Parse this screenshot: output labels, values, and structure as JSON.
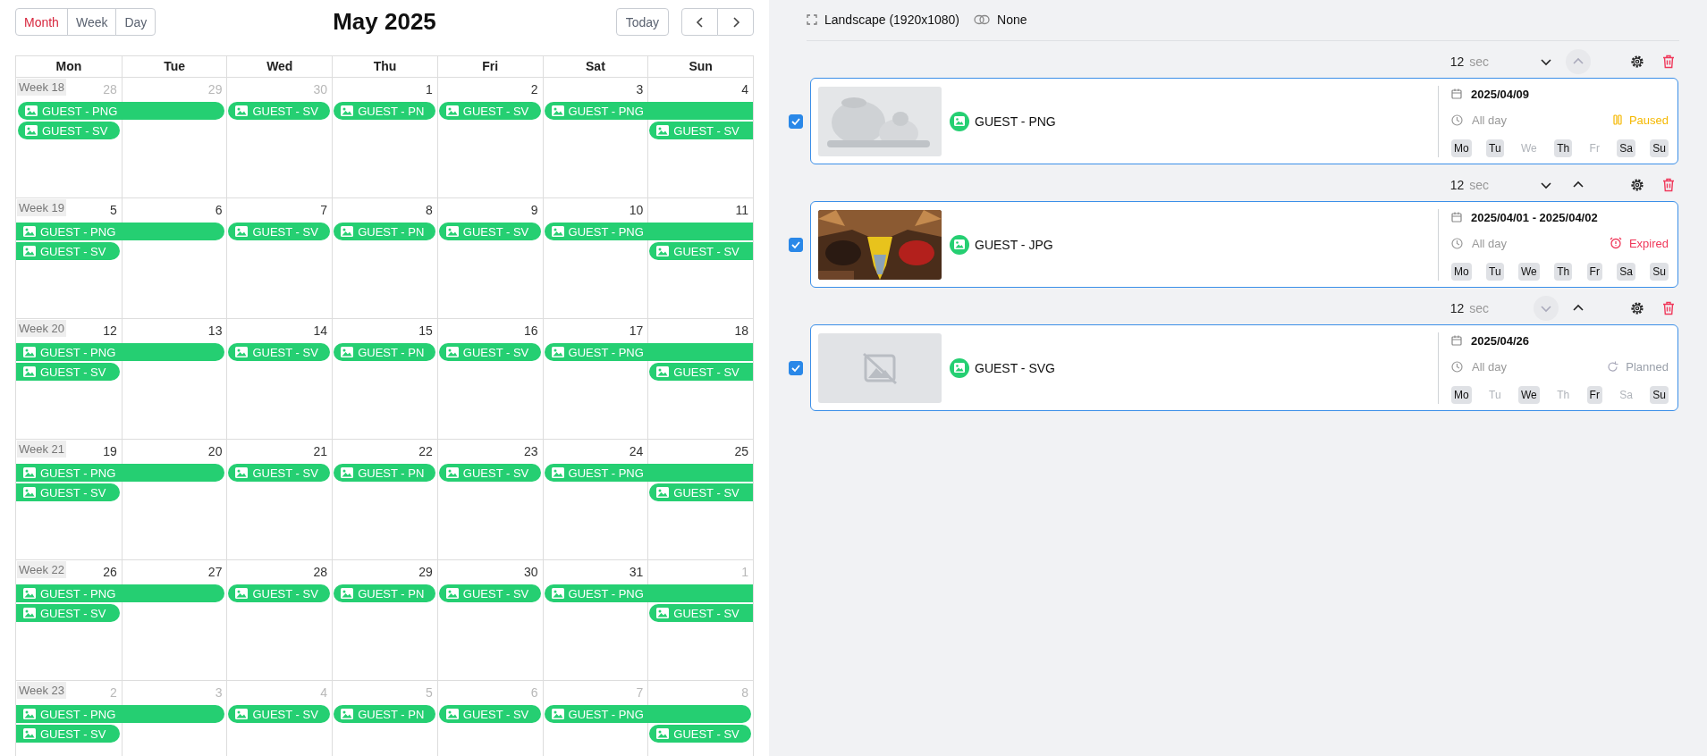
{
  "calendar": {
    "views": [
      {
        "label": "Month",
        "selected": true
      },
      {
        "label": "Week",
        "selected": false
      },
      {
        "label": "Day",
        "selected": false
      }
    ],
    "title": "May 2025",
    "today_button": "Today",
    "weekdays": [
      "Mon",
      "Tue",
      "Wed",
      "Thu",
      "Fri",
      "Sat",
      "Sun"
    ],
    "weeks": [
      {
        "label": "Week 18",
        "days": [
          {
            "date": "28",
            "muted": true,
            "events": [
              {
                "label": "GUEST - PNG",
                "spans_next_day": true,
                "continues_before": false,
                "continues_after": false
              },
              {
                "label": "GUEST - SV",
                "spans_next_day": false,
                "continues_before": false,
                "continues_after": false
              }
            ]
          },
          {
            "date": "29",
            "muted": true
          },
          {
            "date": "30",
            "muted": true,
            "events": [
              {
                "label": "GUEST - SV",
                "spans_next_day": false,
                "continues_before": false,
                "continues_after": false
              }
            ]
          },
          {
            "date": "1",
            "muted": false,
            "events": [
              {
                "label": "GUEST - PN",
                "spans_next_day": false,
                "continues_before": false,
                "continues_after": false
              }
            ]
          },
          {
            "date": "2",
            "muted": false,
            "events": [
              {
                "label": "GUEST - SV",
                "spans_next_day": false,
                "continues_before": false,
                "continues_after": false
              }
            ]
          },
          {
            "date": "3",
            "muted": false,
            "events": [
              {
                "label": "GUEST - PNG",
                "spans_next_day": true,
                "continues_before": false,
                "continues_after": true
              }
            ]
          },
          {
            "date": "4",
            "muted": false,
            "events": [
              {
                "label": "GUEST - SV",
                "continues_before": false,
                "continues_after": true
              }
            ]
          }
        ]
      },
      {
        "label": "Week 19",
        "days": [
          {
            "date": "5",
            "muted": false,
            "events": [
              {
                "label": "GUEST - PNG",
                "spans_next_day": true,
                "continues_before": true,
                "continues_after": false
              },
              {
                "label": "GUEST - SV",
                "spans_next_day": false,
                "continues_before": true,
                "continues_after": false
              }
            ]
          },
          {
            "date": "6",
            "muted": false
          },
          {
            "date": "7",
            "muted": false,
            "events": [
              {
                "label": "GUEST - SV",
                "spans_next_day": false,
                "continues_before": false,
                "continues_after": false
              }
            ]
          },
          {
            "date": "8",
            "muted": false,
            "events": [
              {
                "label": "GUEST - PN",
                "spans_next_day": false,
                "continues_before": false,
                "continues_after": false
              }
            ]
          },
          {
            "date": "9",
            "muted": false,
            "events": [
              {
                "label": "GUEST - SV",
                "spans_next_day": false,
                "continues_before": false,
                "continues_after": false
              }
            ]
          },
          {
            "date": "10",
            "muted": false,
            "events": [
              {
                "label": "GUEST - PNG",
                "spans_next_day": true,
                "continues_before": false,
                "continues_after": true
              }
            ]
          },
          {
            "date": "11",
            "muted": false,
            "events": [
              {
                "label": "GUEST - SV",
                "continues_before": false,
                "continues_after": true
              }
            ]
          }
        ]
      },
      {
        "label": "Week 20",
        "days": [
          {
            "date": "12",
            "muted": false,
            "events": [
              {
                "label": "GUEST - PNG",
                "spans_next_day": true,
                "continues_before": true,
                "continues_after": false
              },
              {
                "label": "GUEST - SV",
                "spans_next_day": false,
                "continues_before": true,
                "continues_after": false
              }
            ]
          },
          {
            "date": "13",
            "muted": false
          },
          {
            "date": "14",
            "muted": false,
            "events": [
              {
                "label": "GUEST - SV",
                "spans_next_day": false,
                "continues_before": false,
                "continues_after": false
              }
            ]
          },
          {
            "date": "15",
            "muted": false,
            "events": [
              {
                "label": "GUEST - PN",
                "spans_next_day": false,
                "continues_before": false,
                "continues_after": false
              }
            ]
          },
          {
            "date": "16",
            "muted": false,
            "events": [
              {
                "label": "GUEST - SV",
                "spans_next_day": false,
                "continues_before": false,
                "continues_after": false
              }
            ]
          },
          {
            "date": "17",
            "muted": false,
            "events": [
              {
                "label": "GUEST - PNG",
                "spans_next_day": true,
                "continues_before": false,
                "continues_after": true
              }
            ]
          },
          {
            "date": "18",
            "muted": false,
            "events": [
              {
                "label": "GUEST - SV",
                "continues_before": false,
                "continues_after": true
              }
            ]
          }
        ]
      },
      {
        "label": "Week 21",
        "days": [
          {
            "date": "19",
            "muted": false,
            "events": [
              {
                "label": "GUEST - PNG",
                "spans_next_day": true,
                "continues_before": true,
                "continues_after": false
              },
              {
                "label": "GUEST - SV",
                "spans_next_day": false,
                "continues_before": true,
                "continues_after": false
              }
            ]
          },
          {
            "date": "20",
            "muted": false
          },
          {
            "date": "21",
            "muted": false,
            "events": [
              {
                "label": "GUEST - SV",
                "spans_next_day": false,
                "continues_before": false,
                "continues_after": false
              }
            ]
          },
          {
            "date": "22",
            "muted": false,
            "events": [
              {
                "label": "GUEST - PN",
                "spans_next_day": false,
                "continues_before": false,
                "continues_after": false
              }
            ]
          },
          {
            "date": "23",
            "muted": false,
            "events": [
              {
                "label": "GUEST - SV",
                "spans_next_day": false,
                "continues_before": false,
                "continues_after": false
              }
            ]
          },
          {
            "date": "24",
            "muted": false,
            "events": [
              {
                "label": "GUEST - PNG",
                "spans_next_day": true,
                "continues_before": false,
                "continues_after": true
              }
            ]
          },
          {
            "date": "25",
            "muted": false,
            "events": [
              {
                "label": "GUEST - SV",
                "continues_before": false,
                "continues_after": true
              }
            ]
          }
        ]
      },
      {
        "label": "Week 22",
        "days": [
          {
            "date": "26",
            "muted": false,
            "events": [
              {
                "label": "GUEST - PNG",
                "spans_next_day": true,
                "continues_before": true,
                "continues_after": false
              },
              {
                "label": "GUEST - SV",
                "spans_next_day": false,
                "continues_before": true,
                "continues_after": false
              }
            ]
          },
          {
            "date": "27",
            "muted": false
          },
          {
            "date": "28",
            "muted": false,
            "events": [
              {
                "label": "GUEST - SV",
                "spans_next_day": false,
                "continues_before": false,
                "continues_after": false
              }
            ]
          },
          {
            "date": "29",
            "muted": false,
            "events": [
              {
                "label": "GUEST - PN",
                "spans_next_day": false,
                "continues_before": false,
                "continues_after": false
              }
            ]
          },
          {
            "date": "30",
            "muted": false,
            "events": [
              {
                "label": "GUEST - SV",
                "spans_next_day": false,
                "continues_before": false,
                "continues_after": false
              }
            ]
          },
          {
            "date": "31",
            "muted": false,
            "events": [
              {
                "label": "GUEST - PNG",
                "spans_next_day": true,
                "continues_before": false,
                "continues_after": true
              }
            ]
          },
          {
            "date": "1",
            "muted": true,
            "events": [
              {
                "label": "GUEST - SV",
                "continues_before": false,
                "continues_after": true
              }
            ]
          }
        ]
      },
      {
        "label": "Week 23",
        "days": [
          {
            "date": "2",
            "muted": true,
            "events": [
              {
                "label": "GUEST - PNG",
                "spans_next_day": true,
                "continues_before": true,
                "continues_after": false
              },
              {
                "label": "GUEST - SV",
                "spans_next_day": false,
                "continues_before": true,
                "continues_after": false
              }
            ]
          },
          {
            "date": "3",
            "muted": true
          },
          {
            "date": "4",
            "muted": true,
            "events": [
              {
                "label": "GUEST - SV",
                "spans_next_day": false,
                "continues_before": false,
                "continues_after": false
              }
            ]
          },
          {
            "date": "5",
            "muted": true,
            "events": [
              {
                "label": "GUEST - PN",
                "spans_next_day": false,
                "continues_before": false,
                "continues_after": false
              }
            ]
          },
          {
            "date": "6",
            "muted": true,
            "events": [
              {
                "label": "GUEST - SV",
                "spans_next_day": false,
                "continues_before": false,
                "continues_after": false
              }
            ]
          },
          {
            "date": "7",
            "muted": true,
            "events": [
              {
                "label": "GUEST - PNG",
                "spans_next_day": true,
                "continues_before": false,
                "continues_after": false
              }
            ]
          },
          {
            "date": "8",
            "muted": true,
            "events": [
              {
                "label": "GUEST - SV",
                "continues_before": false,
                "continues_after": false
              }
            ]
          }
        ]
      }
    ]
  },
  "playlist": {
    "format": "Landscape (1920x1080)",
    "transition": "None",
    "items": [
      {
        "duration": "12",
        "unit": "sec",
        "move_down": {
          "disabled": false
        },
        "move_up": {
          "disabled": true
        },
        "checked": true,
        "name": "GUEST - PNG",
        "date": "2025/04/09",
        "time": "All day",
        "status": {
          "kind": "paused",
          "label": "Paused"
        },
        "days": [
          {
            "label": "Mo",
            "active": true
          },
          {
            "label": "Tu",
            "active": true
          },
          {
            "label": "We",
            "active": false
          },
          {
            "label": "Th",
            "active": true
          },
          {
            "label": "Fr",
            "active": false
          },
          {
            "label": "Sa",
            "active": true
          },
          {
            "label": "Su",
            "active": true
          }
        ]
      },
      {
        "duration": "12",
        "unit": "sec",
        "move_down": {
          "disabled": false
        },
        "move_up": {
          "disabled": false
        },
        "checked": true,
        "name": "GUEST - JPG",
        "date": "2025/04/01 - 2025/04/02",
        "time": "All day",
        "status": {
          "kind": "expired",
          "label": "Expired"
        },
        "days": [
          {
            "label": "Mo",
            "active": true
          },
          {
            "label": "Tu",
            "active": true
          },
          {
            "label": "We",
            "active": true
          },
          {
            "label": "Th",
            "active": true
          },
          {
            "label": "Fr",
            "active": true
          },
          {
            "label": "Sa",
            "active": true
          },
          {
            "label": "Su",
            "active": true
          }
        ]
      },
      {
        "duration": "12",
        "unit": "sec",
        "move_down": {
          "disabled": true
        },
        "move_up": {
          "disabled": false
        },
        "checked": true,
        "thumbnail": {
          "kind": "placeholder"
        },
        "name": "GUEST - SVG",
        "date": "2025/04/26",
        "time": "All day",
        "status": {
          "kind": "planned",
          "label": "Planned"
        },
        "days": [
          {
            "label": "Mo",
            "active": true
          },
          {
            "label": "Tu",
            "active": false
          },
          {
            "label": "We",
            "active": true
          },
          {
            "label": "Th",
            "active": false
          },
          {
            "label": "Fr",
            "active": true
          },
          {
            "label": "Sa",
            "active": false
          },
          {
            "label": "Su",
            "active": true
          }
        ]
      }
    ]
  }
}
